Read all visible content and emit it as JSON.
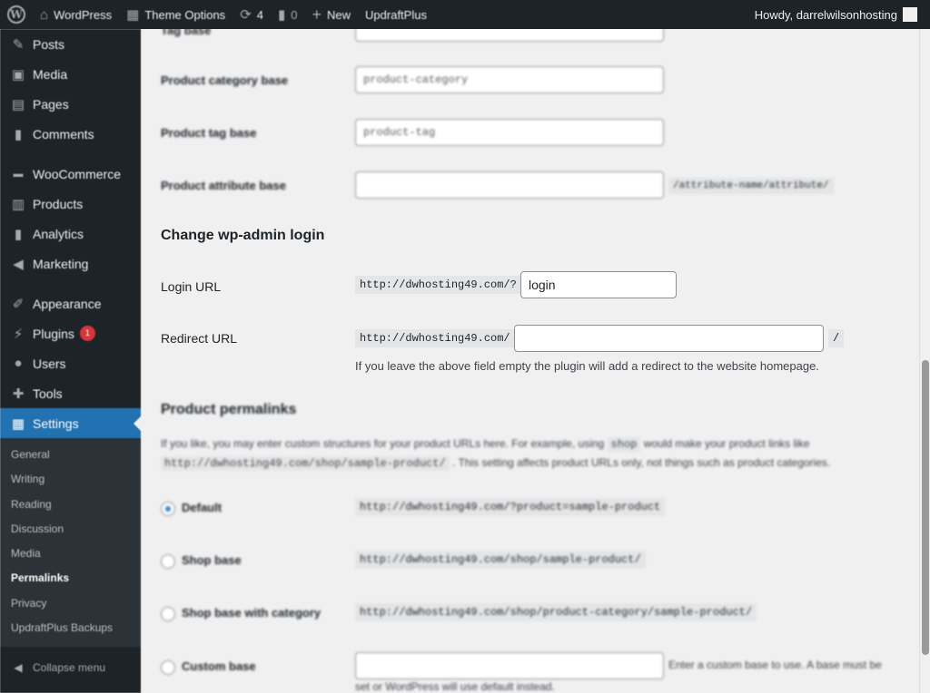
{
  "adminbar": {
    "site_name": "WordPress",
    "theme_options": "Theme Options",
    "updates_count": "4",
    "comments_count": "0",
    "new_label": "New",
    "updraft_label": "UpdraftPlus",
    "howdy": "Howdy, darrelwilsonhosting"
  },
  "sidebar": {
    "items": [
      {
        "label": "Posts",
        "icon": "pin-icon"
      },
      {
        "label": "Media",
        "icon": "media-icon"
      },
      {
        "label": "Pages",
        "icon": "pages-icon"
      },
      {
        "label": "Comments",
        "icon": "comment-icon"
      },
      {
        "label": "WooCommerce",
        "icon": "woo-icon"
      },
      {
        "label": "Products",
        "icon": "products-icon"
      },
      {
        "label": "Analytics",
        "icon": "analytics-icon"
      },
      {
        "label": "Marketing",
        "icon": "megaphone-icon"
      },
      {
        "label": "Appearance",
        "icon": "brush-icon"
      },
      {
        "label": "Plugins",
        "icon": "plug-icon",
        "badge": "1"
      },
      {
        "label": "Users",
        "icon": "user-icon"
      },
      {
        "label": "Tools",
        "icon": "wrench-icon"
      },
      {
        "label": "Settings",
        "icon": "settings-icon"
      }
    ],
    "settings_submenu": [
      "General",
      "Writing",
      "Reading",
      "Discussion",
      "Media",
      "Permalinks",
      "Privacy",
      "UpdraftPlus Backups"
    ],
    "collapse_label": "Collapse menu"
  },
  "content": {
    "tag_base_label": "Tag base",
    "product_category_base_label": "Product category base",
    "product_category_base_value": "product-category",
    "product_tag_base_label": "Product tag base",
    "product_tag_base_value": "product-tag",
    "product_attribute_base_label": "Product attribute base",
    "product_attribute_base_value": "",
    "attribute_suffix": "/attribute-name/attribute/",
    "wp_admin_title": "Change wp-admin login",
    "login_url_label": "Login URL",
    "login_url_prefix": "http://dwhosting49.com/?",
    "login_url_value": "login",
    "redirect_url_label": "Redirect URL",
    "redirect_url_prefix": "http://dwhosting49.com/",
    "redirect_url_value": "",
    "redirect_url_suffix": "/",
    "redirect_help": "If you leave the above field empty the plugin will add a redirect to the website homepage.",
    "product_permalinks_title": "Product permalinks",
    "permalinks_desc_1": "If you like, you may enter custom structures for your product URLs here. For example, using",
    "permalinks_desc_code": "shop",
    "permalinks_desc_2": "would make your product links like",
    "permalinks_desc_code2": "http://dwhosting49.com/shop/sample-product/",
    "permalinks_desc_3": ". This setting affects product URLs only, not things such as product categories.",
    "options": [
      {
        "label": "Default",
        "example": "http://dwhosting49.com/?product=sample-product",
        "checked": true
      },
      {
        "label": "Shop base",
        "example": "http://dwhosting49.com/shop/sample-product/",
        "checked": false
      },
      {
        "label": "Shop base with category",
        "example": "http://dwhosting49.com/shop/product-category/sample-product/",
        "checked": false
      },
      {
        "label": "Custom base",
        "example": "",
        "checked": false
      }
    ],
    "custom_base_help_1": "Enter a custom base to use. A base must be",
    "custom_base_help_2": "set or WordPress will use default instead."
  }
}
